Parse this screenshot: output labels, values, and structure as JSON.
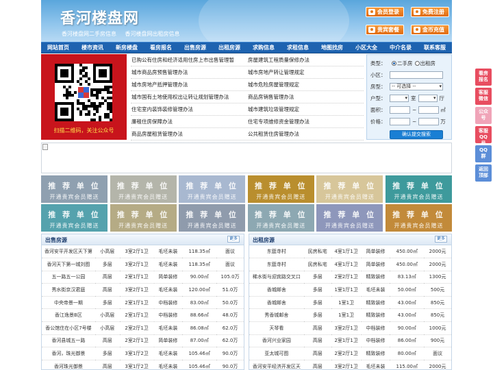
{
  "header": {
    "logo": "香河楼盘网",
    "tagline": [
      "香河楼盘网二手房信息",
      "香河楼盘网出租房信息"
    ],
    "buttons": [
      "会员登录",
      "免费注册",
      "贵宾套餐",
      "金币充值"
    ]
  },
  "nav": [
    "网站首页",
    "楼市资讯",
    "新房楼盘",
    "看房报名",
    "出售房源",
    "出租房源",
    "求购信息",
    "求租信息",
    "地图找房",
    "小区大全",
    "中介名录",
    "联系客服"
  ],
  "qr": {
    "caption": "扫描二维码，关注公众号"
  },
  "links": [
    [
      "已购公有住房和经济适用住房上市出售管理暂",
      "房屋建筑工程质量保修办法"
    ],
    [
      "城市商品房预售管理办法",
      "城市房地产转让管理规定"
    ],
    [
      "城市房地产抵押管理办法",
      "城市危险房屋管理规定"
    ],
    [
      "城市国有土地使用权出让转让规划管理办法",
      "商品房销售管理办法"
    ],
    [
      "住宅室内装饰装修管理办法",
      "城市建筑垃圾管理规定"
    ],
    [
      "廉租住房保障办法",
      "住宅专项维修资金管理办法"
    ],
    [
      "商品房屋租赁管理办法",
      "公共租赁住房管理办法"
    ]
  ],
  "search": {
    "type_label": "类型：",
    "type_options": [
      "二手房",
      "出租房"
    ],
    "community_label": "小区：",
    "housetype_label": "房型：",
    "housetype_select": "-- 可选择 --",
    "layout_label": "户型：",
    "room_unit": "室",
    "hall_unit": "厅",
    "area_label": "面积：",
    "area_unit": "㎡",
    "price_label": "价格：",
    "price_unit": "万",
    "range_sep": "~",
    "submit": "确认提交搜索"
  },
  "recommend": {
    "title": "推 荐 单 位",
    "subtitle": "开通贵宾会员赠送",
    "colors": [
      "#8fa0b0",
      "#b4b5aa",
      "#a8b8d0",
      "#b98e2e",
      "#d7c69a",
      "#3e9a9c",
      "#55a2ad",
      "#b5ab85",
      "#8f9bac",
      "#8da8b2",
      "#8e97bb",
      "#c28a3a"
    ]
  },
  "sale": {
    "title": "出售房源",
    "more": "更多",
    "rows": [
      [
        "香河安平开发区天下第",
        "小高层",
        "3室2厅1卫",
        "毛坯未装",
        "118.35㎡",
        "面议"
      ],
      [
        "香河天下第一城刘图",
        "多层",
        "3室2厅1卫",
        "毛坯未装",
        "118.35㎡",
        "面议"
      ],
      [
        "五一路五一公园",
        "高层",
        "2室1厅1卫",
        "简单装修",
        "90.00㎡",
        "105.0万"
      ],
      [
        "秀水街京汉君庭",
        "高层",
        "3室2厅1卫",
        "毛坯未装",
        "120.00㎡",
        "51.0万"
      ],
      [
        "中央帝景一期",
        "多层",
        "2室1厅1卫",
        "中档装修",
        "83.00㎡",
        "50.0万"
      ],
      [
        "香江逸景B区",
        "小高层",
        "2室1厅1卫",
        "中档装修",
        "88.66㎡",
        "48.0万"
      ],
      [
        "香公馆住在小区7号楼",
        "小高层",
        "2室2厅1卫",
        "毛坯未装",
        "86.08㎡",
        "62.0万"
      ],
      [
        "香河县城五一路",
        "高层",
        "2室2厅1卫",
        "简单装修",
        "87.00㎡",
        "62.0万"
      ],
      [
        "香河，珠光御景",
        "多层",
        "3室1厅2卫",
        "毛坯未装",
        "105.46㎡",
        "90.0万"
      ],
      [
        "香河珠光御景",
        "高层",
        "3室1厅2卫",
        "毛坯未装",
        "105.46㎡",
        "90.0万"
      ]
    ]
  },
  "rent": {
    "title": "出租房源",
    "more": "更多",
    "rows": [
      [
        "东筵寺村",
        "民房私宅",
        "4室1厅1卫",
        "简单装修",
        "450.00㎡",
        "2000元"
      ],
      [
        "东筵寺村",
        "民房私宅",
        "4室1厅1卫",
        "简单装修",
        "450.00㎡",
        "2000元"
      ],
      [
        "稀水街与迎宾路交叉口",
        "多层",
        "2室2厅1卫",
        "精致装修",
        "83.13㎡",
        "1300元"
      ],
      [
        "香城邮舍",
        "多层",
        "1室1厅1卫",
        "毛坯未装",
        "50.00㎡",
        "500元"
      ],
      [
        "香城邮舍",
        "多层",
        "1室1卫",
        "精致装修",
        "43.00㎡",
        "850元"
      ],
      [
        "秀香城邮舍",
        "多层",
        "1室1卫",
        "精致装修",
        "43.00㎡",
        "850元"
      ],
      [
        "天琴看",
        "高层",
        "3室2厅1卫",
        "中档装修",
        "90.00㎡",
        "1000元"
      ],
      [
        "香河兴业家园",
        "高层",
        "2室1厅1卫",
        "中档装修",
        "86.00㎡",
        "900元"
      ],
      [
        "亚太城可图",
        "高层",
        "2室2厅1卫",
        "精致装修",
        "80.00㎡",
        "面议"
      ],
      [
        "香河安平经济开发区天",
        "高层",
        "3室2厅1卫",
        "毛坯未装",
        "115.00㎡",
        "2000元"
      ]
    ]
  },
  "float": [
    {
      "text": "看房报名",
      "color": "#e84d60"
    },
    {
      "text": "客服微信",
      "color": "#e84d60"
    },
    {
      "text": "公众号",
      "color": "#f0a4b8"
    },
    {
      "text": "客服QQ号",
      "color": "#e84d60"
    },
    {
      "text": "QQ群",
      "color": "#5c8ed8"
    },
    {
      "text": "返回顶部",
      "color": "#5c8ed8"
    }
  ]
}
